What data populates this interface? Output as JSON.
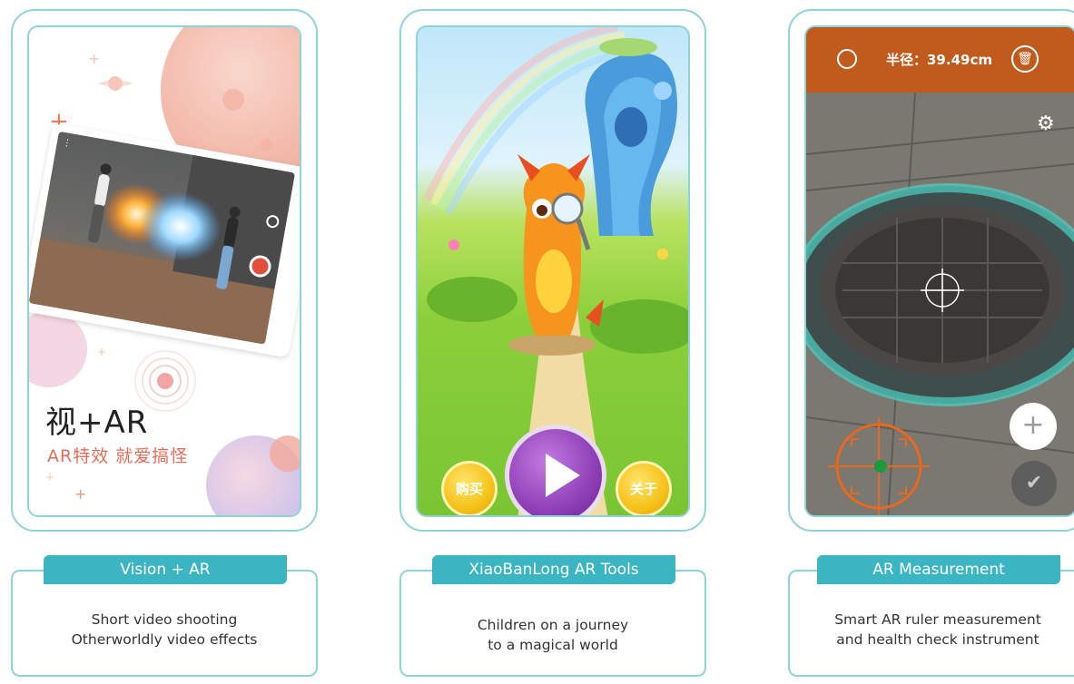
{
  "cards": [
    {
      "id": "vision-ar",
      "tab_label": "Vision + AR",
      "description": [
        "Short video shooting",
        "Otherworldly video effects"
      ],
      "screen": {
        "title": "视+AR",
        "subtitle": "AR特效 就爱搞怪"
      }
    },
    {
      "id": "xiaobanlong",
      "tab_label": "XiaoBanLong AR Tools",
      "description": [
        "Children on a journey",
        "to a magical world"
      ],
      "screen": {
        "buy_label": "购买",
        "about_label": "关于"
      }
    },
    {
      "id": "ar-measurement",
      "tab_label": "AR Measurement",
      "description": [
        "Smart AR ruler measurement",
        "and health check instrument"
      ],
      "screen": {
        "radius_text": "半径：39.49cm"
      }
    }
  ],
  "colors": {
    "frame_border": "#8fd3da",
    "tab_bg": "#3bb5c1",
    "ar_accent": "#e46c57",
    "measure_bar": "#c05a1d",
    "play_purple": "#8e3fb6",
    "button_yellow": "#f5c21b"
  }
}
